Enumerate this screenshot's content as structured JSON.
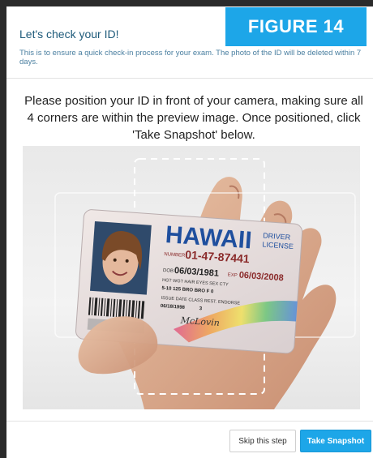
{
  "dialog": {
    "title": "Let's check your ID!",
    "subtitle": "This is to ensure a quick check-in process for your exam. The photo of the ID will be deleted within 7 days.",
    "figure_label": "FIGURE 14",
    "instructions": "Please position your ID in front of your camera, making sure all 4 corners are within the preview image. Once positioned, click 'Take Snapshot' below."
  },
  "id_card": {
    "state": "HAWAII",
    "doc_type_line1": "DRIVER",
    "doc_type_line2": "LICENSE",
    "number_prefix": "NUMBER",
    "number": "01-47-87441",
    "dob_label": "DOB",
    "dob": "06/03/1981",
    "exp_label": "EXP",
    "exp": "06/03/2008",
    "row_labels": "HGT  WGT  HAIR  EYES  SEX  CTY",
    "row_values": "5-10  125  BRO  BRO  F   0",
    "issue_label": "ISSUE DATE  CLASS  REST.  ENDORSE",
    "issue_date": "06/18/1998",
    "class": "3",
    "signature": "McLovin"
  },
  "actions": {
    "skip_label": "Skip this step",
    "snapshot_label": "Take Snapshot"
  },
  "colors": {
    "accent": "#1da6e8",
    "title": "#1d5a7a"
  }
}
